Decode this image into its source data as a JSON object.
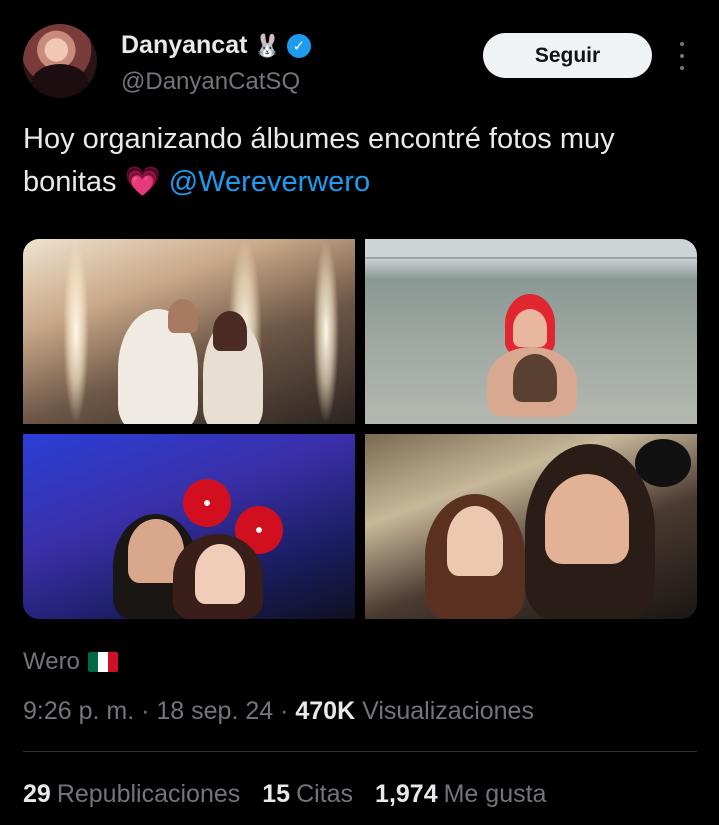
{
  "header": {
    "display_name": "Danyancat",
    "name_emoji": "🐰",
    "verified_icon": "verified-badge-icon",
    "handle": "@DanyanCatSQ",
    "follow_label": "Seguir",
    "more_icon": "more-dots-icon"
  },
  "tweet": {
    "text": "Hoy organizando álbumes encontré fotos muy bonitas",
    "emoji": "💗",
    "mention": "@Wereverwero"
  },
  "media": {
    "photos": [
      "photo-sparkler-couple",
      "photo-beach-couple",
      "photo-minnie-ears-couple",
      "photo-selfie-couple"
    ]
  },
  "tagged": {
    "name": "Wero",
    "flag_icon": "mexico-flag-icon"
  },
  "meta": {
    "time": "9:26 p. m.",
    "separator": " · ",
    "date": "18 sep. 24",
    "views_count": "470K",
    "views_label": "Visualizaciones"
  },
  "stats": {
    "reposts_count": "29",
    "reposts_label": "Republicaciones",
    "quotes_count": "15",
    "quotes_label": "Citas",
    "likes_count": "1,974",
    "likes_label": "Me gusta"
  },
  "colors": {
    "background": "#000000",
    "text": "#e7e9ea",
    "secondary": "#71767b",
    "accent": "#1d9bf0"
  }
}
